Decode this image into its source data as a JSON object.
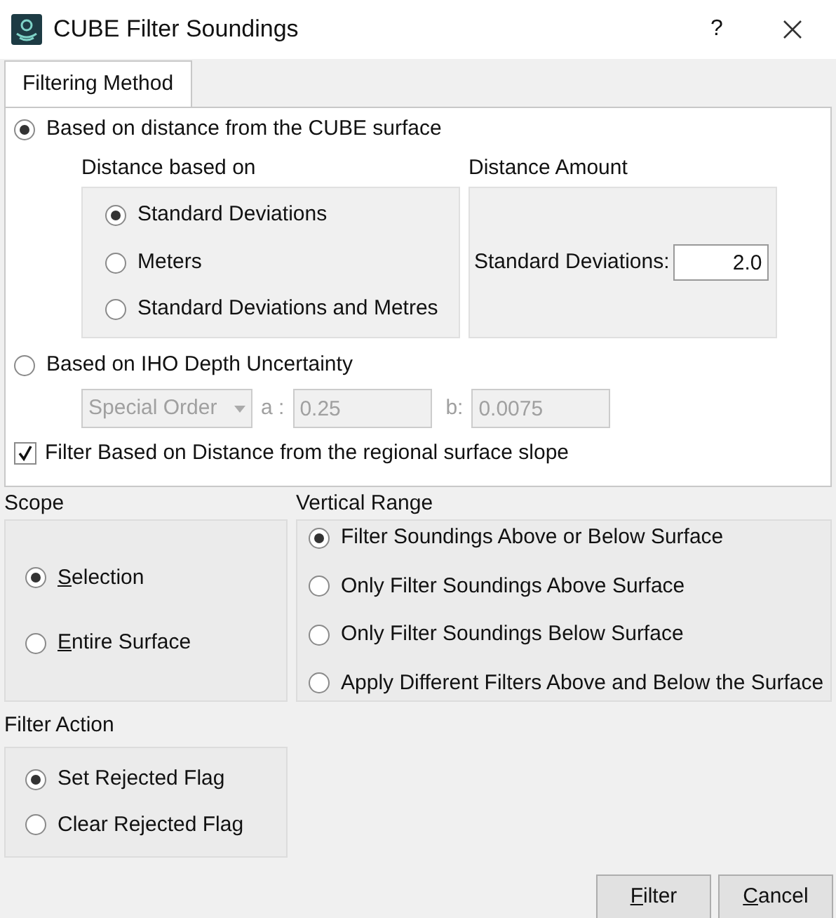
{
  "window": {
    "title": "CUBE Filter Soundings",
    "help": "?"
  },
  "tabs": [
    {
      "label": "Filtering Method",
      "selected": true
    }
  ],
  "method": {
    "options": [
      {
        "label": "Based on distance from the CUBE surface",
        "selected": true
      },
      {
        "label": "Based on IHO Depth Uncertainty",
        "selected": false
      }
    ],
    "distance_based_on": {
      "title": "Distance based on",
      "options": [
        {
          "label": "Standard Deviations",
          "selected": true
        },
        {
          "label": "Meters",
          "selected": false
        },
        {
          "label": "Standard Deviations and Metres",
          "selected": false
        }
      ]
    },
    "distance_amount": {
      "title": "Distance Amount",
      "label": "Standard Deviations:",
      "value": "2.0"
    },
    "iho": {
      "order": "Special Order",
      "a_label": "a :",
      "a_value": "0.25",
      "b_label": "b:",
      "b_value": "0.0075",
      "disabled": true
    },
    "slope": {
      "label": "Filter Based on Distance from the regional surface slope",
      "checked": true
    }
  },
  "scope": {
    "title": "Scope",
    "options": [
      {
        "label": "Selection",
        "selected": true,
        "mnemonic": true
      },
      {
        "label": "Entire Surface",
        "selected": false,
        "mnemonic": true
      }
    ]
  },
  "vertical_range": {
    "title": "Vertical Range",
    "options": [
      {
        "label": "Filter Soundings Above or Below Surface",
        "selected": true
      },
      {
        "label": "Only Filter Soundings Above Surface",
        "selected": false
      },
      {
        "label": "Only Filter Soundings Below Surface",
        "selected": false
      },
      {
        "label": "Apply Different Filters Above and Below the Surface",
        "selected": false
      }
    ]
  },
  "filter_action": {
    "title": "Filter Action",
    "options": [
      {
        "label": "Set Rejected Flag",
        "selected": true,
        "mnemonic": false
      },
      {
        "label": "Clear Rejected Flag",
        "selected": false,
        "mnemonic": false
      }
    ]
  },
  "buttons": [
    {
      "label": "Filter",
      "mnemonic": true
    },
    {
      "label": "Cancel",
      "mnemonic": true
    }
  ]
}
